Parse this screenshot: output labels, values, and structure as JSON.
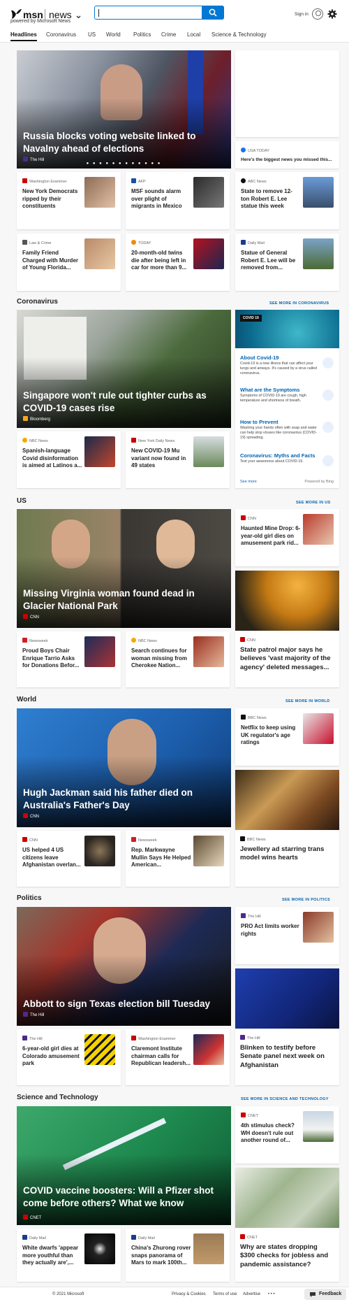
{
  "header": {
    "brand": "msn",
    "product": "news",
    "tagline": "powered by Microsoft News",
    "search_placeholder": "",
    "signin": "Sign in",
    "nav": [
      "Headlines",
      "Coronavirus",
      "US",
      "World",
      "Politics",
      "Crime",
      "Local",
      "Science & Technology"
    ],
    "active_tab": "Headlines"
  },
  "headlines": {
    "hero": {
      "title": "Russia blocks voting website linked to Navalny ahead of elections",
      "source": "The Hill"
    },
    "side_top": {
      "source": "USA TODAY",
      "title": "Here's the biggest news you missed this..."
    },
    "row1": [
      {
        "source": "Washington Examiner",
        "title": "New York Democrats ripped by their constituents"
      },
      {
        "source": "AFP",
        "title": "MSF sounds alarm over plight of migrants in Mexico"
      },
      {
        "source": "ABC News",
        "title": "State to remove 12-ton Robert E. Lee statue this week"
      }
    ],
    "row2": [
      {
        "source": "Law & Crime",
        "title": "Family Friend Charged with Murder of Young Florida..."
      },
      {
        "source": "TODAY",
        "title": "20-month-old twins die after being left in car for more than 9..."
      },
      {
        "source": "Daily Mail",
        "title": "Statue of General Robert E. Lee will be removed from..."
      }
    ]
  },
  "coronavirus": {
    "section": "Coronavirus",
    "see_more": "SEE MORE IN CORONAVIRUS",
    "hero": {
      "title": "Singapore won't rule out tighter curbs as COVID-19 cases rise",
      "source": "Bloomberg"
    },
    "row": [
      {
        "source": "NBC News",
        "title": "Spanish-language Covid disinformation is aimed at Latinos a..."
      },
      {
        "source": "New York Daily News",
        "title": "New COVID-19 Mu variant now found in 49 states"
      }
    ],
    "panel": {
      "chip": "COVID 19",
      "items": [
        {
          "heading": "About Covid-19",
          "body": "Covid-19 is a new illness that can affect your lungs and airways. It's caused by a virus called coronavirus."
        },
        {
          "heading": "What are the Symptoms",
          "body": "Symptoms of COVID-19 are cough, high temperature and shortness of breath."
        },
        {
          "heading": "How to Prevent",
          "body": "Washing your hands often with soap and water can help stop viruses like coronavirus (COVID-19) spreading."
        },
        {
          "heading": "Coronavirus: Myths and Facts",
          "body": "Test your awareness about COVID-19."
        }
      ],
      "see_more": "See more",
      "powered": "Powered by Bing"
    }
  },
  "us": {
    "section": "US",
    "see_more": "SEE MORE IN US",
    "hero": {
      "title": "Missing Virginia woman found dead in Glacier National Park",
      "source": "CNN"
    },
    "side_top": {
      "source": "CNN",
      "title": "Haunted Mine Drop: 6-year-old girl dies on amusement park rid..."
    },
    "side_img": {
      "source": "CNN",
      "title": "State patrol major says he believes 'vast majority of the agency' deleted messages..."
    },
    "row": [
      {
        "source": "Newsweek",
        "title": "Proud Boys Chair Enrique Tarrio Asks for Donations Befor..."
      },
      {
        "source": "NBC News",
        "title": "Search continues for woman missing from Cherokee Nation..."
      }
    ]
  },
  "world": {
    "section": "World",
    "see_more": "SEE MORE IN WORLD",
    "hero": {
      "title": "Hugh Jackman said his father died on Australia's Father's Day",
      "source": "CNN"
    },
    "side_top": {
      "source": "BBC News",
      "title": "Netflix to keep using UK regulator's age ratings"
    },
    "side_img": {
      "source": "BBC News",
      "title": "Jewellery ad starring trans model wins hearts"
    },
    "row": [
      {
        "source": "CNN",
        "title": "US helped 4 US citizens leave Afghanistan overlan..."
      },
      {
        "source": "Newsweek",
        "title": "Rep. Markwayne Mullin Says He Helped American..."
      }
    ]
  },
  "politics": {
    "section": "Politics",
    "see_more": "SEE MORE IN POLITICS",
    "hero": {
      "title": "Abbott to sign Texas election bill Tuesday",
      "source": "The Hill"
    },
    "side_top": {
      "source": "The Hill",
      "title": "PRO Act limits worker rights"
    },
    "side_img": {
      "source": "The Hill",
      "title": "Blinken to testify before Senate panel next week on Afghanistan"
    },
    "row": [
      {
        "source": "The Hill",
        "title": "6-year-old girl dies at Colorado amusement park"
      },
      {
        "source": "Washington Examiner",
        "title": "Claremont Institute chairman calls for Republican leadersh..."
      }
    ]
  },
  "science": {
    "section": "Science and Technology",
    "see_more": "SEE MORE IN SCIENCE AND TECHNOLOGY",
    "hero": {
      "title": "COVID vaccine boosters: Will a Pfizer shot come before others? What we know",
      "source": "CNET"
    },
    "side_top": {
      "source": "CNET",
      "title": "4th stimulus check? WH doesn't rule out another round of..."
    },
    "side_img": {
      "source": "CNET",
      "title": "Why are states dropping $300 checks for jobless and pandemic assistance?"
    },
    "row": [
      {
        "source": "Daily Mail",
        "title": "White dwarfs 'appear more youthful than they actually are',..."
      },
      {
        "source": "Daily Mail",
        "title": "China's Zhurong rover snaps panorama of Mars to mark 100th..."
      }
    ]
  },
  "footer": {
    "copyright": "© 2021 Microsoft",
    "links": [
      "Privacy & Cookies",
      "Terms of use",
      "Advertise"
    ],
    "more": "• • •",
    "feedback": "Feedback"
  },
  "colors": {
    "accent": "#0078d4",
    "link": "#0063b1",
    "page_bg": "#f7f7f7"
  }
}
